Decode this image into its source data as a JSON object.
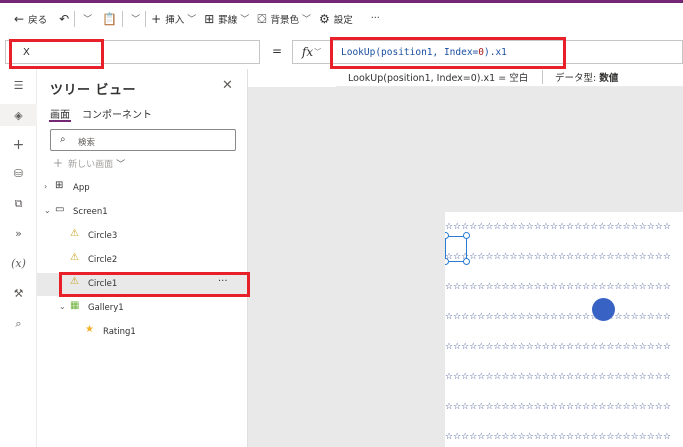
{
  "toolbar": {
    "back_label": "戻る",
    "insert_label": "挿入",
    "border_label": "罫線",
    "fill_label": "背景色",
    "settings_label": "設定",
    "more_label": "···"
  },
  "formula_bar": {
    "property": "X",
    "equals": "=",
    "fx": "fx",
    "formula_prefix": "LookUp(position1, Index=",
    "formula_number": "0",
    "formula_suffix": ").x1"
  },
  "hint": {
    "expression": "LookUp(position1, Index=0).x1  =  空白",
    "type_label": "データ型:",
    "type_value": "数値"
  },
  "tree": {
    "title": "ツリー ビュー",
    "tabs": [
      "画面",
      "コンポーネント"
    ],
    "search_placeholder": "検索",
    "new_screen_label": "新しい画面",
    "nodes": [
      {
        "label": "App"
      },
      {
        "label": "Screen1"
      },
      {
        "label": "Circle3"
      },
      {
        "label": "Circle2"
      },
      {
        "label": "Circle1"
      },
      {
        "label": "Gallery1"
      },
      {
        "label": "Rating1"
      }
    ],
    "more": "···"
  },
  "canvas": {
    "star_row": "☆☆☆☆☆☆☆☆☆☆☆☆☆☆☆☆☆☆☆☆☆☆☆☆☆☆☆☆"
  },
  "colors": {
    "accent": "#742774",
    "highlight": "#e8202a",
    "circle": "#3862c4",
    "selection": "#2b7cd3"
  }
}
